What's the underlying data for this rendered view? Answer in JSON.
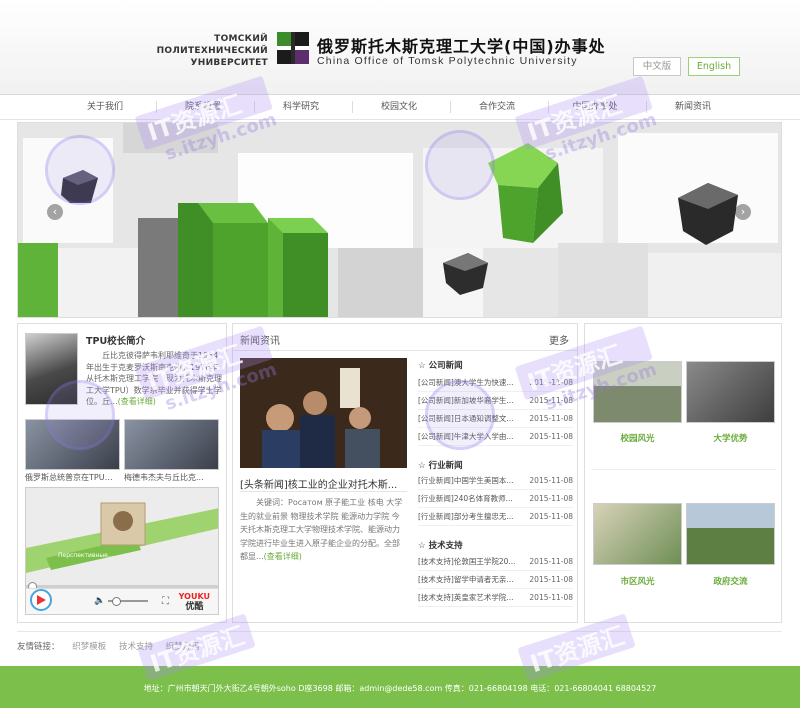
{
  "header": {
    "ru_name": [
      "ТОМСКИЙ",
      "ПОЛИТЕХНИЧЕСКИЙ",
      "УНИВЕРСИТЕТ"
    ],
    "cn_title": "俄罗斯托木斯克理工大学(中国)办事处",
    "en_title": "China Office of Tomsk Polytechnic University",
    "lang_cn": "中文版",
    "lang_en": "English"
  },
  "nav": [
    "关于我们",
    "院系设置",
    "科学研究",
    "校园文化",
    "合作交流",
    "中国办事处",
    "新闻资讯"
  ],
  "president": {
    "title": "TPU校长简介",
    "text": "丘比克彼得萨韦利耶维奇于1954年出生于克麦罗沃斯南克州。1976年从托木斯克理工学院（现为托木斯克理工大学TPU）数学系毕业并获得学士学位。丘...",
    "more": "(查看详细)"
  },
  "thumbs": [
    {
      "caption": "俄罗斯总统普京在TPU现..."
    },
    {
      "caption": "梅德韦杰夫与丘比克..."
    }
  ],
  "video": {
    "youku_top": "YOUKU",
    "youku_bottom": "优酷",
    "film_title": "Перспективные..."
  },
  "news": {
    "title": "新闻资讯",
    "more": "更多",
    "headline": "[头条新闻]核工业的企业对托木斯...",
    "summary": "关键词：Росатом 原子能工业 核电 大学生的就业前景 物理技术学院 能源动力学院 今天托木斯克理工大学物理技术学院、能源动力学院进行毕业生进入原子能企业的分配。全部都显...",
    "summary_more": "(查看详细)",
    "categories": [
      {
        "title": "☆ 公司新闻",
        "items": [
          {
            "t": "[公司新闻]澳大学生为快速...",
            "d": "2015-11-08"
          },
          {
            "t": "[公司新闻]新加坡华裔学生...",
            "d": "2015-11-08"
          },
          {
            "t": "[公司新闻]日本通知调整文...",
            "d": "2015-11-08"
          },
          {
            "t": "[公司新闻]牛津大学入学由...",
            "d": "2015-11-08"
          }
        ]
      },
      {
        "title": "☆ 行业新闻",
        "items": [
          {
            "t": "[行业新闻]中国学生美国本...",
            "d": "2015-11-08"
          },
          {
            "t": "[行业新闻]240名体育教师...",
            "d": "2015-11-08"
          },
          {
            "t": "[行业新闻]部分考生擅忠无...",
            "d": "2015-11-08"
          }
        ]
      },
      {
        "title": "☆ 技术支持",
        "items": [
          {
            "t": "[技术支持]伦敦国王学院20...",
            "d": "2015-11-08"
          },
          {
            "t": "[技术支持]留学申请者无亲...",
            "d": "2015-11-08"
          },
          {
            "t": "[技术支持]英皇家艺术学院...",
            "d": "2015-11-08"
          }
        ]
      }
    ]
  },
  "gallery": [
    {
      "caption": "校园风光",
      "color_a": "#7d8a6e",
      "color_b": "#c9d0c2"
    },
    {
      "caption": "大学优势",
      "color_a": "#3e3e3e",
      "color_b": "#8a8a8a"
    },
    {
      "caption": "市区风光",
      "color_a": "#6e8f55",
      "color_b": "#d8d2b8"
    },
    {
      "caption": "政府交流",
      "color_a": "#5d7f44",
      "color_b": "#b7c8d9"
    }
  ],
  "links": {
    "label": "友情链接：",
    "items": [
      "织梦模板",
      "技术支持",
      "织梦源码"
    ]
  },
  "footer": {
    "text": "地址：广州市朝天门外大街乙4号朝外soho D座3698 邮箱：admin@dede58.com 传真：021-66804198 电话：021-66804041 68804527"
  },
  "watermark": {
    "line1": "IT资源汇",
    "line2": "s.itzyh.com"
  },
  "colors": {
    "accent": "#7cc04b",
    "accent_text": "#6bab3a"
  }
}
